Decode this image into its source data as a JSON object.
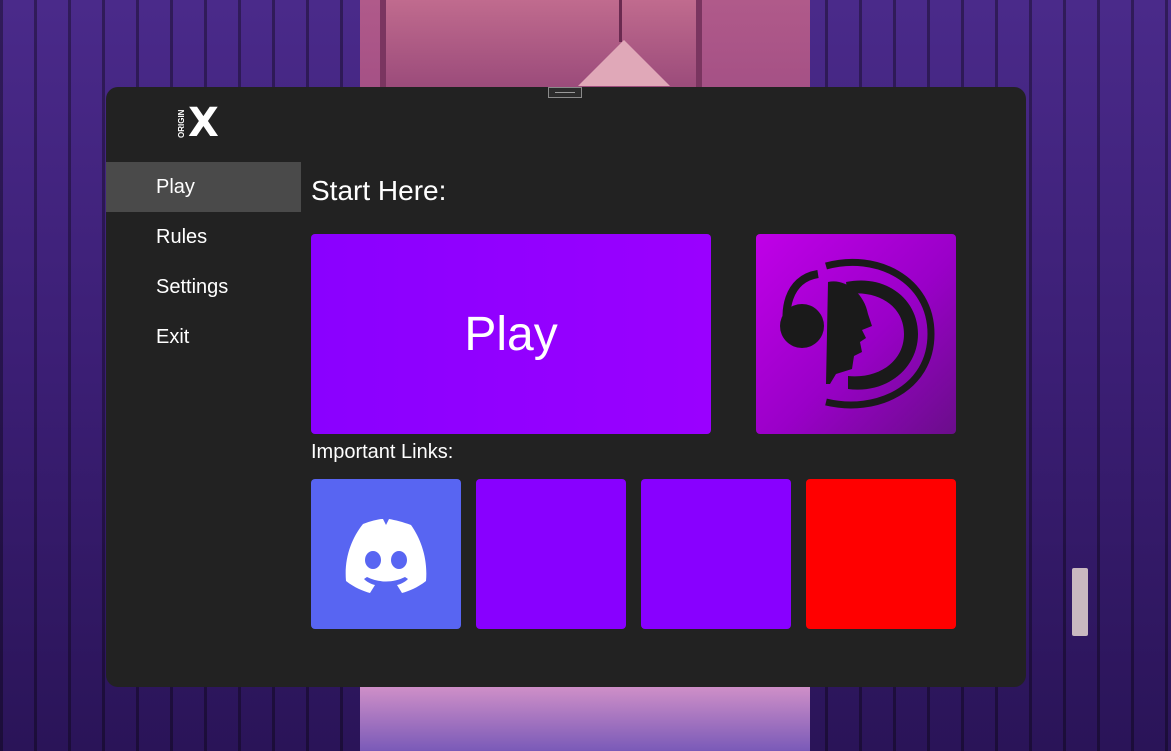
{
  "app": {
    "logo_small_text": "ORIGIN",
    "logo_main_text": "X"
  },
  "sidebar": {
    "items": [
      {
        "label": "Play",
        "active": true
      },
      {
        "label": "Rules",
        "active": false
      },
      {
        "label": "Settings",
        "active": false
      },
      {
        "label": "Exit",
        "active": false
      }
    ]
  },
  "main": {
    "start_title": "Start Here:",
    "play_label": "Play",
    "links_title": "Important Links:",
    "links": [
      {
        "icon": "discord-icon",
        "color": "#5865f2"
      },
      {
        "icon": "",
        "color": "#8800ff"
      },
      {
        "icon": "",
        "color": "#8800ff"
      },
      {
        "icon": "",
        "color": "#ff0000"
      }
    ],
    "teamspeak_icon": "teamspeak-icon"
  },
  "colors": {
    "window_bg": "#222222",
    "active_nav": "#4a4a4a",
    "accent_purple": "#8a00ff",
    "discord_blurple": "#5865f2",
    "red": "#ff0000"
  }
}
